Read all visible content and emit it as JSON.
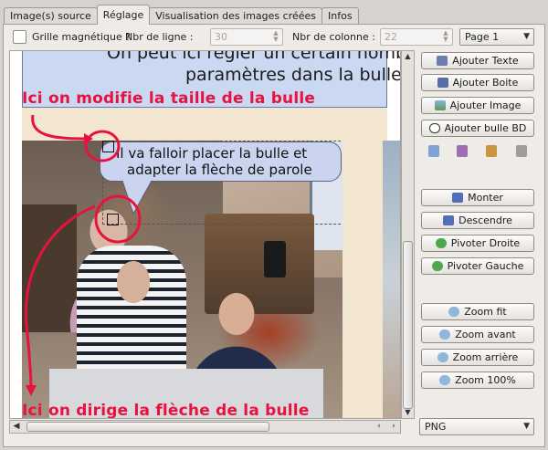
{
  "tabs": [
    {
      "label": "Image(s) source",
      "active": false
    },
    {
      "label": "Réglage",
      "active": true
    },
    {
      "label": "Visualisation des images créées",
      "active": false
    },
    {
      "label": "Infos",
      "active": false
    }
  ],
  "options": {
    "grille_label": "Grille magnétique ?",
    "nbr_ligne_label": "Nbr de ligne :",
    "nbr_ligne_value": "30",
    "nbr_colonne_label": "Nbr de colonne :",
    "nbr_colonne_value": "22",
    "page_select": "Page 1"
  },
  "canvas": {
    "top_bubble_line1": "On peut ici régler un certain nombre de",
    "top_bubble_line2": "paramètres dans la bulle",
    "annotation_top": "Ici on modifie la taille de la bulle",
    "bubble_line1": "Il va falloir placer la bulle et",
    "bubble_line2": "adapter la flèche de parole",
    "annotation_bottom": "Ici on dirige la flèche de la bulle"
  },
  "buttons": {
    "ajouter_texte": "Ajouter Texte",
    "ajouter_boite": "Ajouter Boite",
    "ajouter_image": "Ajouter Image",
    "ajouter_bulle": "Ajouter bulle BD",
    "monter": "Monter",
    "descendre": "Descendre",
    "pivoter_droite": "Pivoter Droite",
    "pivoter_gauche": "Pivoter Gauche",
    "zoom_fit": "Zoom fit",
    "zoom_avant": "Zoom avant",
    "zoom_arriere": "Zoom arrière",
    "zoom_100": "Zoom 100%"
  },
  "format_select": "PNG",
  "colors": {
    "annotation_red": "#e8123e",
    "bubble_blue": "#cbd4ef",
    "panel_bg": "#efebe7"
  }
}
